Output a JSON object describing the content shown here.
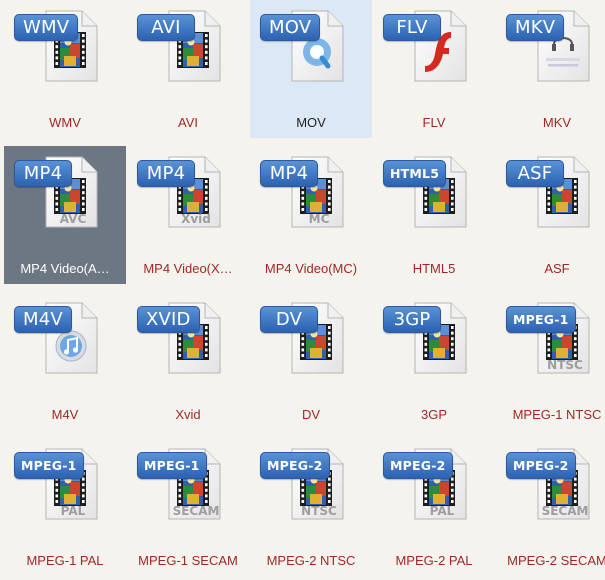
{
  "colors": {
    "caption": "#a02828",
    "selected_bg": "#6d7783",
    "hover_bg": "#dce8f5",
    "badge": "#3a74c4"
  },
  "formats": [
    {
      "badge": "WMV",
      "label": "WMV",
      "icon": "film-icon",
      "sub": ""
    },
    {
      "badge": "AVI",
      "label": "AVI",
      "icon": "film-icon",
      "sub": ""
    },
    {
      "badge": "MOV",
      "label": "MOV",
      "icon": "quicktime-icon",
      "sub": "",
      "state": "hover"
    },
    {
      "badge": "FLV",
      "label": "FLV",
      "icon": "flash-icon",
      "sub": ""
    },
    {
      "badge": "MKV",
      "label": "MKV",
      "icon": "matroska-icon",
      "sub": "",
      "logo_text": "матрешка MATROSKA"
    },
    {
      "badge": "MP4",
      "label": "MP4 Video(A…",
      "icon": "film-icon",
      "sub": "AVC",
      "state": "selected"
    },
    {
      "badge": "MP4",
      "label": "MP4 Video(X…",
      "icon": "film-icon",
      "sub": "Xvid"
    },
    {
      "badge": "MP4",
      "label": "MP4 Video(MC)",
      "icon": "film-icon",
      "sub": "MC"
    },
    {
      "badge": "HTML5",
      "label": "HTML5",
      "icon": "film-icon",
      "sub": ""
    },
    {
      "badge": "ASF",
      "label": "ASF",
      "icon": "film-icon",
      "sub": ""
    },
    {
      "badge": "M4V",
      "label": "M4V",
      "icon": "itunes-icon",
      "sub": ""
    },
    {
      "badge": "XVID",
      "label": "Xvid",
      "icon": "film-icon",
      "sub": ""
    },
    {
      "badge": "DV",
      "label": "DV",
      "icon": "film-icon",
      "sub": ""
    },
    {
      "badge": "3GP",
      "label": "3GP",
      "icon": "film-icon",
      "sub": ""
    },
    {
      "badge": "MPEG-1",
      "label": "MPEG-1 NTSC",
      "icon": "film-icon",
      "sub": "NTSC"
    },
    {
      "badge": "MPEG-1",
      "label": "MPEG-1 PAL",
      "icon": "film-icon",
      "sub": "PAL"
    },
    {
      "badge": "MPEG-1",
      "label": "MPEG-1 SECAM",
      "icon": "film-icon",
      "sub": "SECAM"
    },
    {
      "badge": "MPEG-2",
      "label": "MPEG-2 NTSC",
      "icon": "film-icon",
      "sub": "NTSC"
    },
    {
      "badge": "MPEG-2",
      "label": "MPEG-2 PAL",
      "icon": "film-icon",
      "sub": "PAL"
    },
    {
      "badge": "MPEG-2",
      "label": "MPEG-2 SECAM",
      "icon": "film-icon",
      "sub": "SECAM"
    }
  ]
}
